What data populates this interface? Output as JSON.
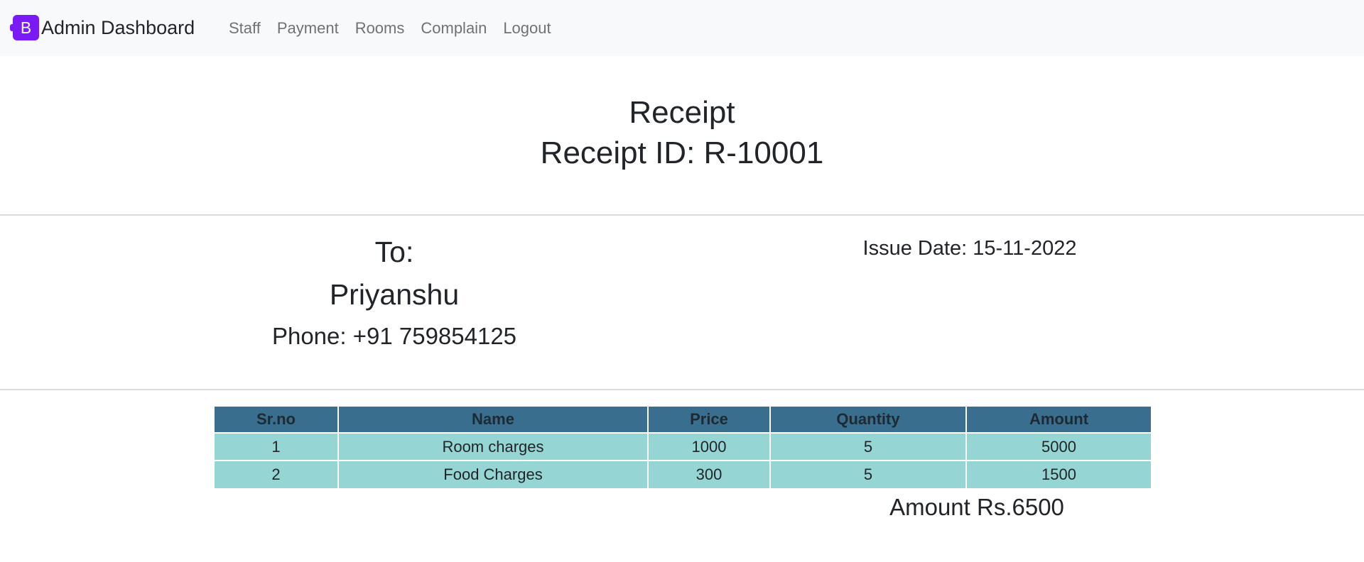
{
  "navbar": {
    "brand_letter": "B",
    "brand_text": "Admin Dashboard",
    "links": [
      "Staff",
      "Payment",
      "Rooms",
      "Complain",
      "Logout"
    ],
    "background": "#f8f9fa",
    "brand_color": "#7a1af5"
  },
  "receipt": {
    "title": "Receipt",
    "id_line": "Receipt ID: R-10001",
    "to_label": "To:",
    "to_name": "Priyanshu",
    "to_phone": "Phone: +91 759854125",
    "issue_date": "Issue Date: 15-11-2022",
    "total": "Amount Rs.6500"
  },
  "table": {
    "headers": [
      "Sr.no",
      "Name",
      "Price",
      "Quantity",
      "Amount"
    ],
    "rows": [
      [
        "1",
        "Room charges",
        "1000",
        "5",
        "5000"
      ],
      [
        "2",
        "Food Charges",
        "300",
        "5",
        "1500"
      ]
    ],
    "header_color": "#3a6e8f",
    "row_color": "#95d5d3"
  }
}
